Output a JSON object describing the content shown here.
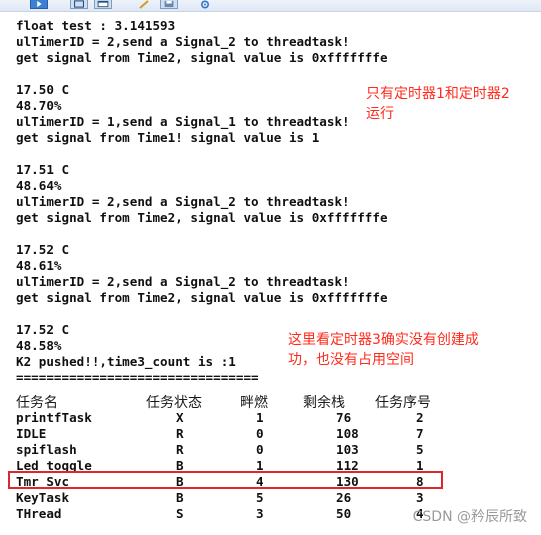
{
  "toolbar": {
    "buttons": [
      {
        "icon": "play-icon",
        "active": true
      },
      {
        "icon": "panel-icon",
        "active": false
      },
      {
        "icon": "window-icon",
        "active": false
      },
      {
        "icon": "pencil-icon",
        "active": false
      },
      {
        "icon": "save-icon",
        "active": false
      },
      {
        "icon": "gear-icon",
        "active": false
      }
    ]
  },
  "log_lines": [
    "float test : 3.141593",
    "ulTimerID = 2,send a Signal_2 to threadtask!",
    "get signal from Time2, signal value is 0xfffffffe",
    "",
    "17.50 C",
    "48.70%",
    "ulTimerID = 1,send a Signal_1 to threadtask!",
    "get signal from Time1! signal value is 1",
    "",
    "17.51 C",
    "48.64%",
    "ulTimerID = 2,send a Signal_2 to threadtask!",
    "get signal from Time2, signal value is 0xfffffffe",
    "",
    "17.52 C",
    "48.61%",
    "ulTimerID = 2,send a Signal_2 to threadtask!",
    "get signal from Time2, signal value is 0xfffffffe",
    "",
    "17.52 C",
    "48.58%",
    "K2 pushed!!,time3_count is :1",
    "================================"
  ],
  "annotations": {
    "note1_line1": "只有定时器1和定时器2",
    "note1_line2": "运行",
    "note2_line1": "这里看定时器3确实没有创建成",
    "note2_line2": "功，也没有占用空间"
  },
  "task_table": {
    "headers": [
      "任务名",
      "任务状态",
      "畔燃",
      "剩余栈",
      "任务序号"
    ],
    "rows": [
      [
        "printfTask",
        "X",
        "1",
        "76",
        "2"
      ],
      [
        "IDLE",
        "R",
        "0",
        "108",
        "7"
      ],
      [
        "spiflash",
        "R",
        "0",
        "103",
        "5"
      ],
      [
        "Led toggle",
        "B",
        "1",
        "112",
        "1"
      ],
      [
        "Tmr Svc",
        "B",
        "4",
        "130",
        "8"
      ],
      [
        "KeyTask",
        "B",
        "5",
        "26",
        "3"
      ],
      [
        "THread",
        "S",
        "3",
        "50",
        "4"
      ]
    ],
    "highlighted_row": "Tmr Svc",
    "highlight_color": "#e0262d"
  },
  "watermark": "CSDN @矜辰所致",
  "colors": {
    "annotation_text": "#ff2b1c",
    "terminal_text": "#101010"
  }
}
